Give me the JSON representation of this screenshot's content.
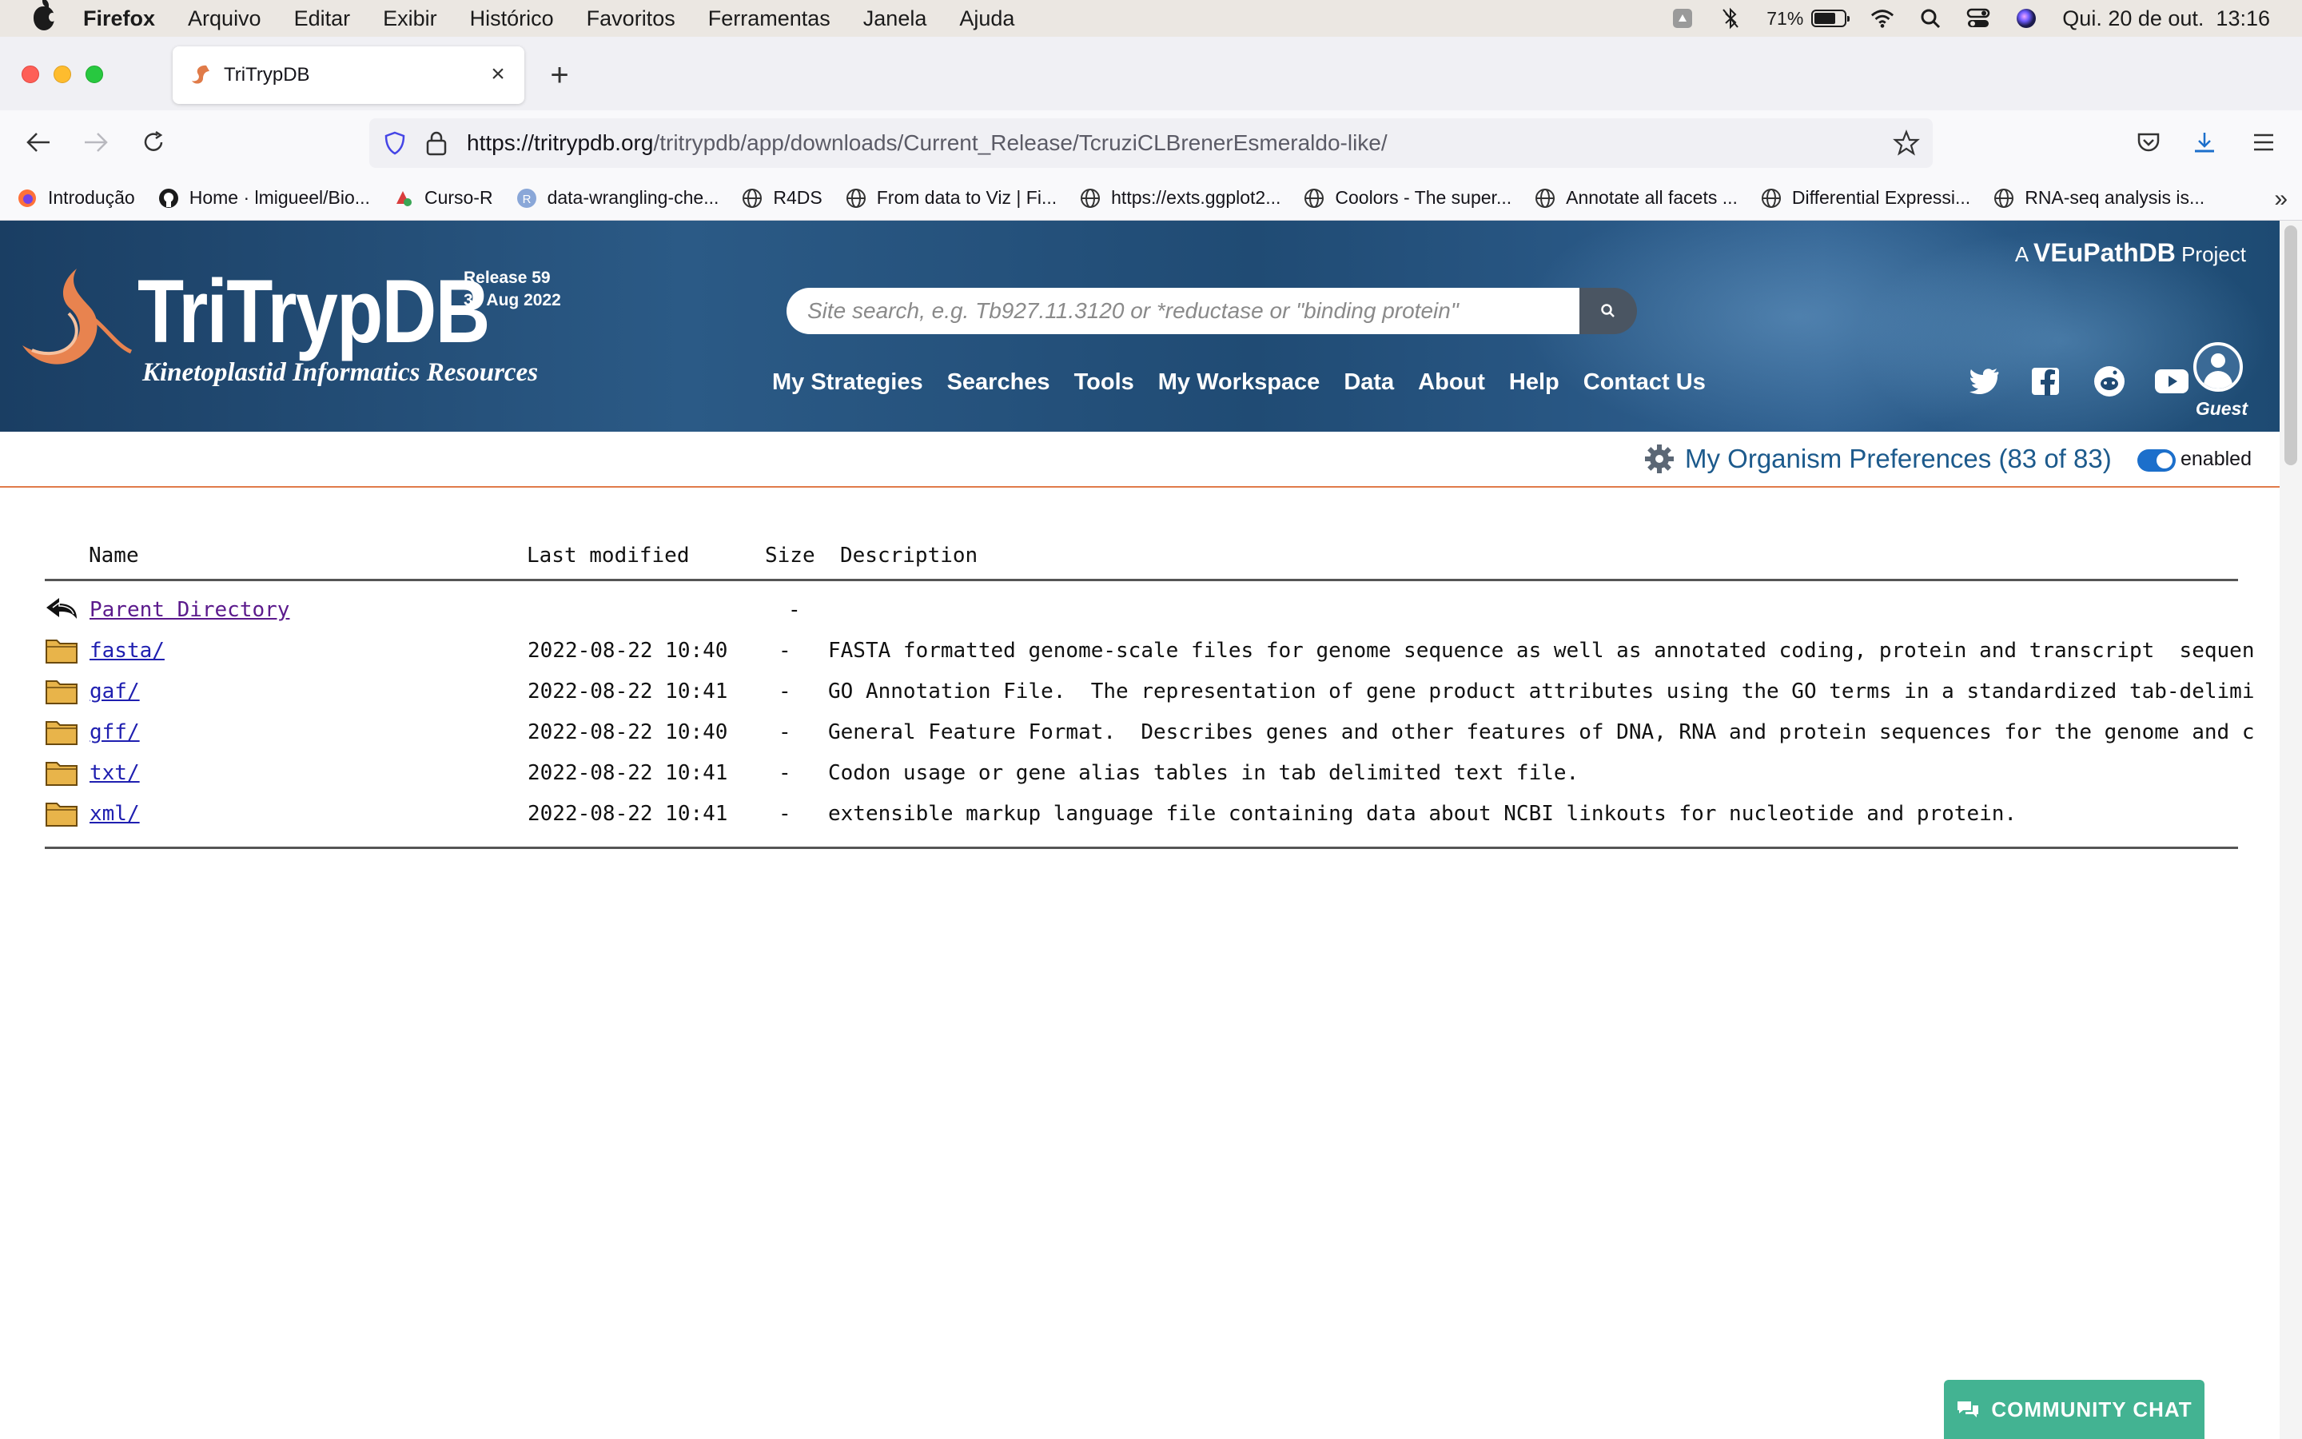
{
  "menubar": {
    "app": "Firefox",
    "items": [
      "Arquivo",
      "Editar",
      "Exibir",
      "Histórico",
      "Favoritos",
      "Ferramentas",
      "Janela",
      "Ajuda"
    ],
    "battery": "71%",
    "datetime": "Qui. 20 de out.  13:16"
  },
  "browser": {
    "tab_title": "TriTrypDB",
    "url_host": "https://tritrypdb.org",
    "url_path": "/tritrypdb/app/downloads/Current_Release/TcruziCLBrenerEsmeraldo-like/",
    "bookmarks": [
      {
        "label": "Introdução",
        "icon": "firefox-icon"
      },
      {
        "label": "Home · lmigueel/Bio...",
        "icon": "github-icon"
      },
      {
        "label": "Curso-R",
        "icon": "curso-r-icon"
      },
      {
        "label": "data-wrangling-che...",
        "icon": "r-icon"
      },
      {
        "label": "R4DS",
        "icon": "globe-icon"
      },
      {
        "label": "From data to Viz | Fi...",
        "icon": "globe-icon"
      },
      {
        "label": "https://exts.ggplot2...",
        "icon": "globe-icon"
      },
      {
        "label": "Coolors - The super...",
        "icon": "globe-icon"
      },
      {
        "label": "Annotate all facets ...",
        "icon": "globe-icon"
      },
      {
        "label": "Differential Expressi...",
        "icon": "globe-icon"
      },
      {
        "label": "RNA-seq analysis is...",
        "icon": "globe-icon"
      }
    ]
  },
  "site": {
    "title": "TriTrypDB",
    "subtitle": "Kinetoplastid Informatics Resources",
    "release_line1": "Release 59",
    "release_line2": "30 Aug 2022",
    "search_placeholder": "Site search, e.g. Tb927.11.3120 or *reductase or \"binding protein\"",
    "nav": [
      "My Strategies",
      "Searches",
      "Tools",
      "My Workspace",
      "Data",
      "About",
      "Help",
      "Contact Us"
    ],
    "vpdb_prefix": "A",
    "vpdb_name": "VEuPathDB",
    "vpdb_suffix": "Project",
    "guest_label": "Guest",
    "prefs_label": "My Organism Preferences (83 of 83)",
    "prefs_toggle": "enabled",
    "chat_label": "COMMUNITY CHAT"
  },
  "listing": {
    "headers": {
      "name": "Name",
      "last_modified": "Last modified",
      "size": "Size",
      "description": "Description"
    },
    "parent": {
      "name": "Parent Directory",
      "size": "-"
    },
    "rows": [
      {
        "name": "fasta/",
        "date": "2022-08-22 10:40",
        "size": "-",
        "description": "FASTA formatted genome-scale files for genome sequence as well as annotated coding, protein and transcript  sequen"
      },
      {
        "name": "gaf/",
        "date": "2022-08-22 10:41",
        "size": "-",
        "description": "GO Annotation File.  The representation of gene product attributes using the GO terms in a standardized tab-delimi"
      },
      {
        "name": "gff/",
        "date": "2022-08-22 10:40",
        "size": "-",
        "description": "General Feature Format.  Describes genes and other features of DNA, RNA and protein sequences for the genome and c"
      },
      {
        "name": "txt/",
        "date": "2022-08-22 10:41",
        "size": "-",
        "description": "Codon usage or gene alias tables in tab delimited text file."
      },
      {
        "name": "xml/",
        "date": "2022-08-22 10:41",
        "size": "-",
        "description": "extensible markup language file containing data about NCBI linkouts for nucleotide and protein."
      }
    ]
  },
  "colors": {
    "header_blue": "#204b74",
    "link_blue": "#1c5a8c",
    "accent_orange": "#e07b49",
    "chat_green": "#43b392"
  }
}
